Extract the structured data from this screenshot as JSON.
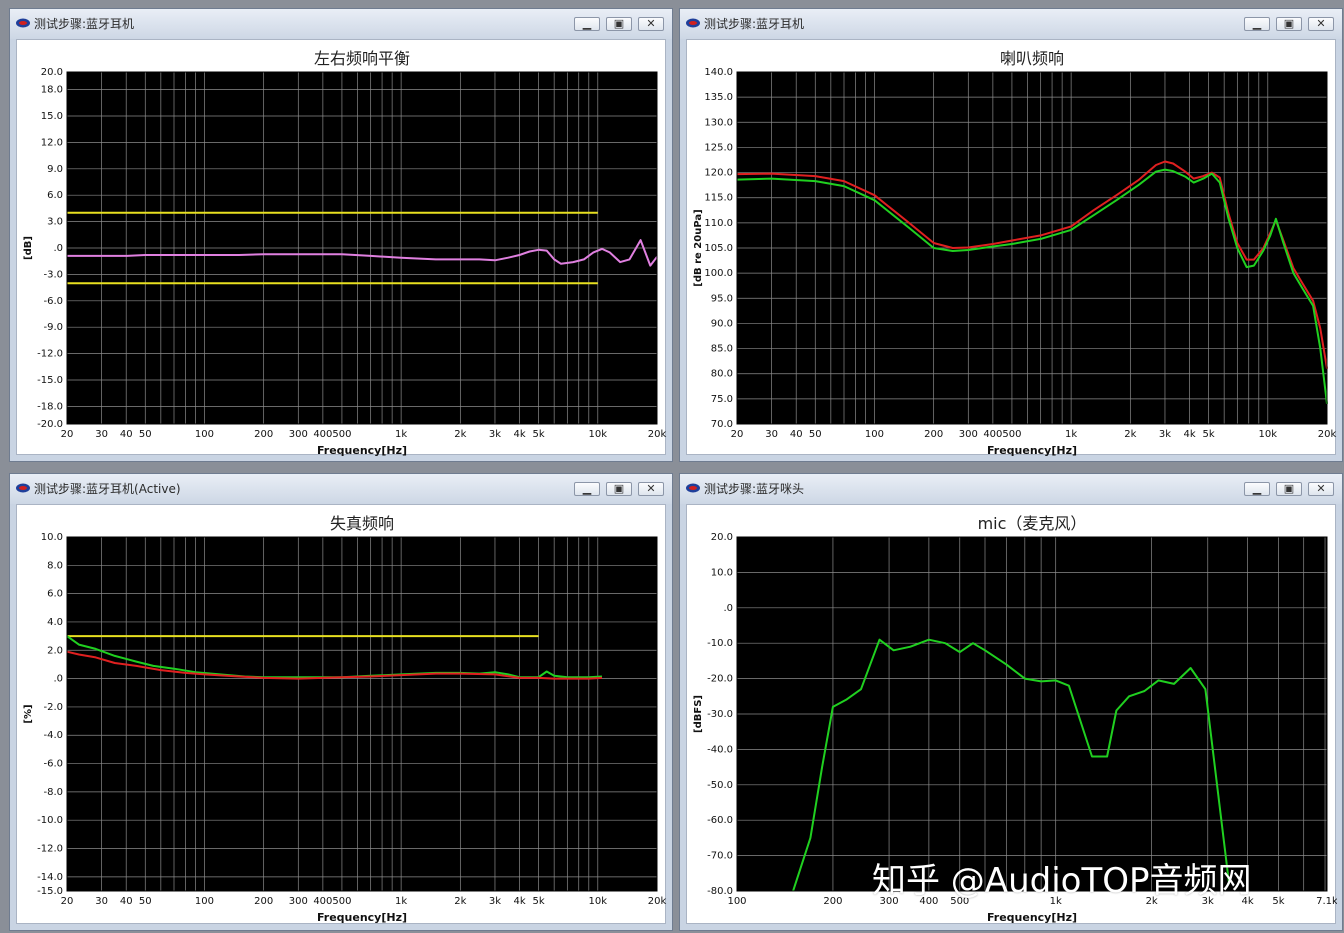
{
  "windows": [
    {
      "id": "w0",
      "title": "测试步骤:蓝牙耳机",
      "minimize": "▁",
      "maximize": "▣",
      "close": "✕"
    },
    {
      "id": "w1",
      "title": "测试步骤:蓝牙耳机",
      "minimize": "▁",
      "maximize": "▣",
      "close": "✕"
    },
    {
      "id": "w2",
      "title": "测试步骤:蓝牙耳机(Active)",
      "minimize": "▁",
      "maximize": "▣",
      "close": "✕"
    },
    {
      "id": "w3",
      "title": "测试步骤:蓝牙咪头",
      "minimize": "▁",
      "maximize": "▣",
      "close": "✕"
    }
  ],
  "watermark": "知乎 @AudioTOP音频网",
  "colors": {
    "plot_bg": "#000000",
    "grid": "#8c8c8c",
    "yellow": "#e8e020",
    "pink": "#e080e0",
    "green": "#20d020",
    "red": "#e02020"
  },
  "chart_data": [
    {
      "type": "line",
      "title": "左右频响平衡",
      "xlabel": "Frequency[Hz]",
      "ylabel": "[dB]",
      "xscale": "log",
      "xlim": [
        20,
        20000
      ],
      "ylim": [
        -20,
        20
      ],
      "yticks": [
        20,
        18,
        15,
        12,
        9,
        6,
        3,
        0,
        -3,
        -6,
        -9,
        -12,
        -15,
        -18,
        -20
      ],
      "ytick_labels": [
        "20.0",
        "18.0",
        "15.0",
        "12.0",
        "9.0",
        "6.0",
        "3.0",
        ".0",
        "-3.0",
        "-6.0",
        "-9.0",
        "-12.0",
        "-15.0",
        "-18.0",
        "-20.0"
      ],
      "xticks": [
        20,
        30,
        40,
        50,
        100,
        200,
        300,
        400,
        500,
        1000,
        2000,
        3000,
        4000,
        5000,
        10000,
        20000
      ],
      "xtick_labels": [
        "20",
        "30",
        "40",
        "50",
        "100",
        "200",
        "300",
        "400",
        "500",
        "1k",
        "2k",
        "3k",
        "4k",
        "5k",
        "10k",
        "20k"
      ],
      "grid": true,
      "series": [
        {
          "color": "#e8e020",
          "points": [
            [
              20,
              4
            ],
            [
              10000,
              4
            ]
          ]
        },
        {
          "color": "#e8e020",
          "points": [
            [
              20,
              -4
            ],
            [
              10000,
              -4
            ]
          ]
        },
        {
          "color": "#e080e0",
          "points": [
            [
              20,
              -0.9
            ],
            [
              40,
              -0.9
            ],
            [
              50,
              -0.8
            ],
            [
              100,
              -0.8
            ],
            [
              150,
              -0.8
            ],
            [
              200,
              -0.7
            ],
            [
              300,
              -0.7
            ],
            [
              500,
              -0.7
            ],
            [
              700,
              -0.9
            ],
            [
              1000,
              -1.1
            ],
            [
              1500,
              -1.3
            ],
            [
              2000,
              -1.3
            ],
            [
              2500,
              -1.3
            ],
            [
              3000,
              -1.4
            ],
            [
              3500,
              -1.1
            ],
            [
              4000,
              -0.8
            ],
            [
              4500,
              -0.4
            ],
            [
              5000,
              -0.2
            ],
            [
              5500,
              -0.3
            ],
            [
              6000,
              -1.3
            ],
            [
              6500,
              -1.8
            ],
            [
              7500,
              -1.6
            ],
            [
              8500,
              -1.3
            ],
            [
              9500,
              -0.5
            ],
            [
              10500,
              -0.1
            ],
            [
              11500,
              -0.5
            ],
            [
              13000,
              -1.6
            ],
            [
              14500,
              -1.3
            ],
            [
              16500,
              0.9
            ],
            [
              18500,
              -2.0
            ],
            [
              20000,
              -1.0
            ]
          ]
        }
      ]
    },
    {
      "type": "line",
      "title": "喇叭频响",
      "xlabel": "Frequency[Hz]",
      "ylabel": "[dB re 20uPa]",
      "xscale": "log",
      "xlim": [
        20,
        20000
      ],
      "ylim": [
        70,
        140
      ],
      "yticks": [
        140,
        135,
        130,
        125,
        120,
        115,
        110,
        105,
        100,
        95,
        90,
        85,
        80,
        75,
        70
      ],
      "ytick_labels": [
        "140.0",
        "135.0",
        "130.0",
        "125.0",
        "120.0",
        "115.0",
        "110.0",
        "105.0",
        "100.0",
        "95.0",
        "90.0",
        "85.0",
        "80.0",
        "75.0",
        "70.0"
      ],
      "xticks": [
        20,
        30,
        40,
        50,
        100,
        200,
        300,
        400,
        500,
        1000,
        2000,
        3000,
        4000,
        5000,
        10000,
        20000
      ],
      "xtick_labels": [
        "20",
        "30",
        "40",
        "50",
        "100",
        "200",
        "300",
        "400",
        "500",
        "1k",
        "2k",
        "3k",
        "4k",
        "5k",
        "10k",
        "20k"
      ],
      "grid": true,
      "series": [
        {
          "color": "#e02020",
          "points": [
            [
              20,
              119.7
            ],
            [
              30,
              119.8
            ],
            [
              50,
              119.3
            ],
            [
              70,
              118.3
            ],
            [
              100,
              115.5
            ],
            [
              150,
              110.0
            ],
            [
              200,
              106.0
            ],
            [
              250,
              105.0
            ],
            [
              300,
              105.1
            ],
            [
              400,
              105.8
            ],
            [
              500,
              106.5
            ],
            [
              700,
              107.5
            ],
            [
              1000,
              109.3
            ],
            [
              1300,
              112.5
            ],
            [
              1700,
              115.5
            ],
            [
              2200,
              118.5
            ],
            [
              2700,
              121.5
            ],
            [
              3000,
              122.2
            ],
            [
              3300,
              121.8
            ],
            [
              3800,
              120.2
            ],
            [
              4200,
              118.8
            ],
            [
              4700,
              119.3
            ],
            [
              5200,
              120.0
            ],
            [
              5700,
              119.0
            ],
            [
              6300,
              112.0
            ],
            [
              7000,
              106.0
            ],
            [
              7800,
              102.7
            ],
            [
              8500,
              102.7
            ],
            [
              9500,
              105.0
            ],
            [
              10300,
              108.0
            ],
            [
              11000,
              110.5
            ],
            [
              12000,
              106.5
            ],
            [
              13500,
              101.0
            ],
            [
              15000,
              98.0
            ],
            [
              17000,
              94.5
            ],
            [
              18500,
              89.0
            ],
            [
              20000,
              81.0
            ]
          ]
        },
        {
          "color": "#20d020",
          "points": [
            [
              20,
              118.6
            ],
            [
              30,
              118.8
            ],
            [
              50,
              118.3
            ],
            [
              70,
              117.3
            ],
            [
              100,
              114.5
            ],
            [
              150,
              109.0
            ],
            [
              200,
              105.0
            ],
            [
              250,
              104.4
            ],
            [
              300,
              104.6
            ],
            [
              400,
              105.3
            ],
            [
              500,
              105.8
            ],
            [
              700,
              106.8
            ],
            [
              1000,
              108.6
            ],
            [
              1300,
              111.5
            ],
            [
              1700,
              114.5
            ],
            [
              2200,
              117.5
            ],
            [
              2700,
              120.2
            ],
            [
              3000,
              120.6
            ],
            [
              3300,
              120.3
            ],
            [
              3800,
              119.2
            ],
            [
              4200,
              118.0
            ],
            [
              4700,
              118.8
            ],
            [
              5200,
              119.8
            ],
            [
              5700,
              118.0
            ],
            [
              6300,
              111.0
            ],
            [
              7000,
              105.0
            ],
            [
              7800,
              101.2
            ],
            [
              8500,
              101.5
            ],
            [
              9500,
              104.5
            ],
            [
              10300,
              107.5
            ],
            [
              11000,
              110.8
            ],
            [
              12000,
              106.0
            ],
            [
              13500,
              100.0
            ],
            [
              15000,
              97.0
            ],
            [
              17000,
              93.5
            ],
            [
              18500,
              85.0
            ],
            [
              20000,
              74.0
            ]
          ]
        }
      ]
    },
    {
      "type": "line",
      "title": "失真频响",
      "xlabel": "Frequency[Hz]",
      "ylabel": "[%]",
      "xscale": "log",
      "xlim": [
        20,
        20000
      ],
      "ylim": [
        -15,
        10
      ],
      "yticks": [
        10,
        8,
        6,
        4,
        2,
        0,
        -2,
        -4,
        -6,
        -8,
        -10,
        -12,
        -14,
        -15
      ],
      "ytick_labels": [
        "10.0",
        "8.0",
        "6.0",
        "4.0",
        "2.0",
        ".0",
        "-2.0",
        "-4.0",
        "-6.0",
        "-8.0",
        "-10.0",
        "-12.0",
        "-14.0",
        "-15.0"
      ],
      "xticks": [
        20,
        30,
        40,
        50,
        100,
        200,
        300,
        400,
        500,
        1000,
        2000,
        3000,
        4000,
        5000,
        10000,
        20000
      ],
      "xtick_labels": [
        "20",
        "30",
        "40",
        "50",
        "100",
        "200",
        "300",
        "400",
        "500",
        "1k",
        "2k",
        "3k",
        "4k",
        "5k",
        "10k",
        "20k"
      ],
      "grid": true,
      "series": [
        {
          "color": "#e8e020",
          "points": [
            [
              20,
              3.0
            ],
            [
              5000,
              3.0
            ]
          ]
        },
        {
          "color": "#20d020",
          "points": [
            [
              20,
              3.0
            ],
            [
              23,
              2.4
            ],
            [
              28,
              2.1
            ],
            [
              35,
              1.6
            ],
            [
              45,
              1.2
            ],
            [
              55,
              0.9
            ],
            [
              70,
              0.7
            ],
            [
              90,
              0.45
            ],
            [
              120,
              0.3
            ],
            [
              160,
              0.15
            ],
            [
              200,
              0.1
            ],
            [
              300,
              0.1
            ],
            [
              500,
              0.1
            ],
            [
              700,
              0.2
            ],
            [
              1000,
              0.3
            ],
            [
              1500,
              0.4
            ],
            [
              2000,
              0.4
            ],
            [
              2500,
              0.35
            ],
            [
              3000,
              0.45
            ],
            [
              3500,
              0.3
            ],
            [
              4000,
              0.1
            ],
            [
              5000,
              0.1
            ],
            [
              5500,
              0.5
            ],
            [
              6000,
              0.2
            ],
            [
              7000,
              0.1
            ],
            [
              9000,
              0.1
            ],
            [
              10500,
              0.15
            ]
          ]
        },
        {
          "color": "#e02020",
          "points": [
            [
              20,
              1.9
            ],
            [
              23,
              1.7
            ],
            [
              28,
              1.5
            ],
            [
              35,
              1.1
            ],
            [
              45,
              0.9
            ],
            [
              60,
              0.6
            ],
            [
              80,
              0.4
            ],
            [
              100,
              0.3
            ],
            [
              150,
              0.15
            ],
            [
              200,
              0.05
            ],
            [
              300,
              0.0
            ],
            [
              500,
              0.1
            ],
            [
              700,
              0.15
            ],
            [
              1000,
              0.25
            ],
            [
              1500,
              0.35
            ],
            [
              2000,
              0.35
            ],
            [
              3000,
              0.3
            ],
            [
              4000,
              0.05
            ],
            [
              5000,
              0.05
            ],
            [
              6000,
              0.0
            ],
            [
              9000,
              0.0
            ],
            [
              10500,
              0.05
            ]
          ]
        }
      ]
    },
    {
      "type": "line",
      "title": "mic（麦克风）",
      "xlabel": "Frequency[Hz]",
      "ylabel": "[dBFS]",
      "xscale": "log",
      "xlim": [
        100,
        7100
      ],
      "ylim": [
        -80,
        20
      ],
      "yticks": [
        20,
        10,
        0,
        -10,
        -20,
        -30,
        -40,
        -50,
        -60,
        -70,
        -80
      ],
      "ytick_labels": [
        "20.0",
        "10.0",
        ".0",
        "-10.0",
        "-20.0",
        "-30.0",
        "-40.0",
        "-50.0",
        "-60.0",
        "-70.0",
        "-80.0"
      ],
      "xticks": [
        100,
        200,
        300,
        400,
        500,
        1000,
        2000,
        3000,
        4000,
        5000,
        7100
      ],
      "xtick_labels": [
        "100",
        "200",
        "300",
        "400",
        "500",
        "1k",
        "2k",
        "3k",
        "4k",
        "5k",
        "7.1k"
      ],
      "grid": true,
      "series": [
        {
          "color": "#20d020",
          "points": [
            [
              150,
              -80
            ],
            [
              170,
              -65
            ],
            [
              185,
              -45
            ],
            [
              200,
              -28
            ],
            [
              220,
              -26
            ],
            [
              245,
              -23
            ],
            [
              280,
              -9
            ],
            [
              310,
              -12
            ],
            [
              350,
              -11
            ],
            [
              400,
              -9
            ],
            [
              450,
              -10
            ],
            [
              500,
              -12.5
            ],
            [
              550,
              -10
            ],
            [
              600,
              -12
            ],
            [
              700,
              -16
            ],
            [
              800,
              -20
            ],
            [
              900,
              -20.8
            ],
            [
              1000,
              -20.5
            ],
            [
              1100,
              -22
            ],
            [
              1300,
              -42
            ],
            [
              1450,
              -42
            ],
            [
              1550,
              -29
            ],
            [
              1700,
              -25
            ],
            [
              1900,
              -23.5
            ],
            [
              2100,
              -20.5
            ],
            [
              2350,
              -21.5
            ],
            [
              2650,
              -17
            ],
            [
              2950,
              -23
            ],
            [
              3500,
              -78
            ]
          ]
        }
      ]
    }
  ]
}
